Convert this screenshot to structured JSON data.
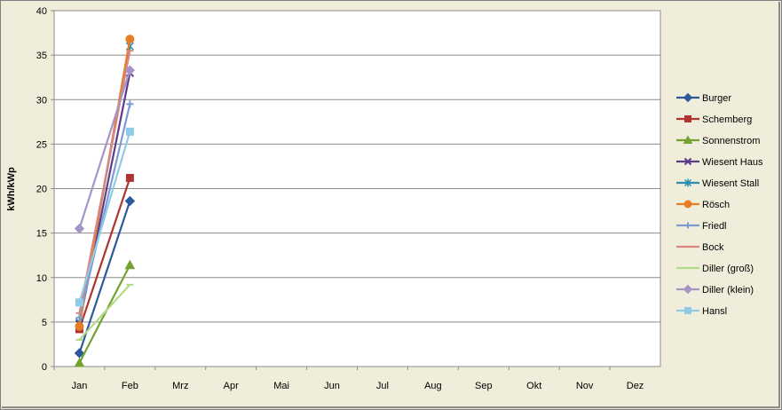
{
  "chart_data": {
    "type": "line",
    "title": "",
    "xlabel": "",
    "ylabel": "kWh/kWp",
    "ylim": [
      0,
      40
    ],
    "yticks": [
      0,
      5,
      10,
      15,
      20,
      25,
      30,
      35,
      40
    ],
    "categories": [
      "Jan",
      "Feb",
      "Mrz",
      "Apr",
      "Mai",
      "Jun",
      "Jul",
      "Aug",
      "Sep",
      "Okt",
      "Nov",
      "Dez"
    ],
    "grid": "horizontal",
    "legend_position": "right",
    "series": [
      {
        "name": "Burger",
        "color": "#2e5a9c",
        "marker": "diamond",
        "values": [
          1.5,
          18.6
        ]
      },
      {
        "name": "Schemberg",
        "color": "#b03430",
        "marker": "square",
        "values": [
          4.2,
          21.2
        ]
      },
      {
        "name": "Sonnenstrom",
        "color": "#73a230",
        "marker": "triangle",
        "values": [
          0.4,
          11.4
        ]
      },
      {
        "name": "Wiesent Haus",
        "color": "#5e3a8a",
        "marker": "x",
        "values": [
          4.8,
          33.0
        ]
      },
      {
        "name": "Wiesent Stall",
        "color": "#2b8eb0",
        "marker": "star",
        "values": [
          5.0,
          36.0
        ]
      },
      {
        "name": "Rösch",
        "color": "#e57d25",
        "marker": "circle",
        "values": [
          4.5,
          36.8
        ]
      },
      {
        "name": "Friedl",
        "color": "#7e9cd4",
        "marker": "plus",
        "values": [
          5.5,
          29.5
        ]
      },
      {
        "name": "Bock",
        "color": "#d98683",
        "marker": "dash",
        "values": [
          6.0,
          35.5
        ]
      },
      {
        "name": "Diller (groß)",
        "color": "#b5d98a",
        "marker": "dash",
        "values": [
          3.0,
          9.2
        ]
      },
      {
        "name": "Diller (klein)",
        "color": "#a595c7",
        "marker": "diamond",
        "values": [
          15.5,
          33.3
        ]
      },
      {
        "name": "Hansl",
        "color": "#8fcbe6",
        "marker": "square",
        "values": [
          7.2,
          26.4
        ]
      }
    ]
  }
}
